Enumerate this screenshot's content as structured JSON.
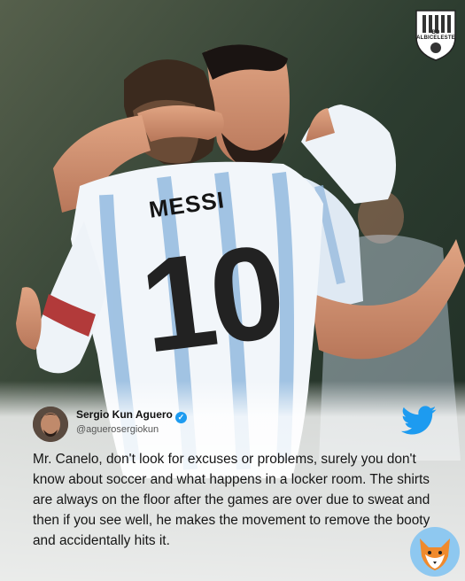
{
  "brand": {
    "badge_text": "BD ALBICELESTE"
  },
  "jersey": {
    "name": "MESSI",
    "number": "10"
  },
  "tweet": {
    "author_name": "Sergio Kun Aguero",
    "handle": "@aguerosergiokun",
    "text": "Mr. Canelo, don't look for excuses or problems, surely you don't know about soccer and what happens in a locker room. The shirts are always on the floor after the games are over due to sweat and then if you see well, he makes the movement to remove the booty and accidentally hits it.",
    "accent_color": "#1d9bf0"
  },
  "icons": [
    "verified-icon",
    "twitter-bird-icon",
    "fox-logo-icon",
    "shield-icon"
  ]
}
